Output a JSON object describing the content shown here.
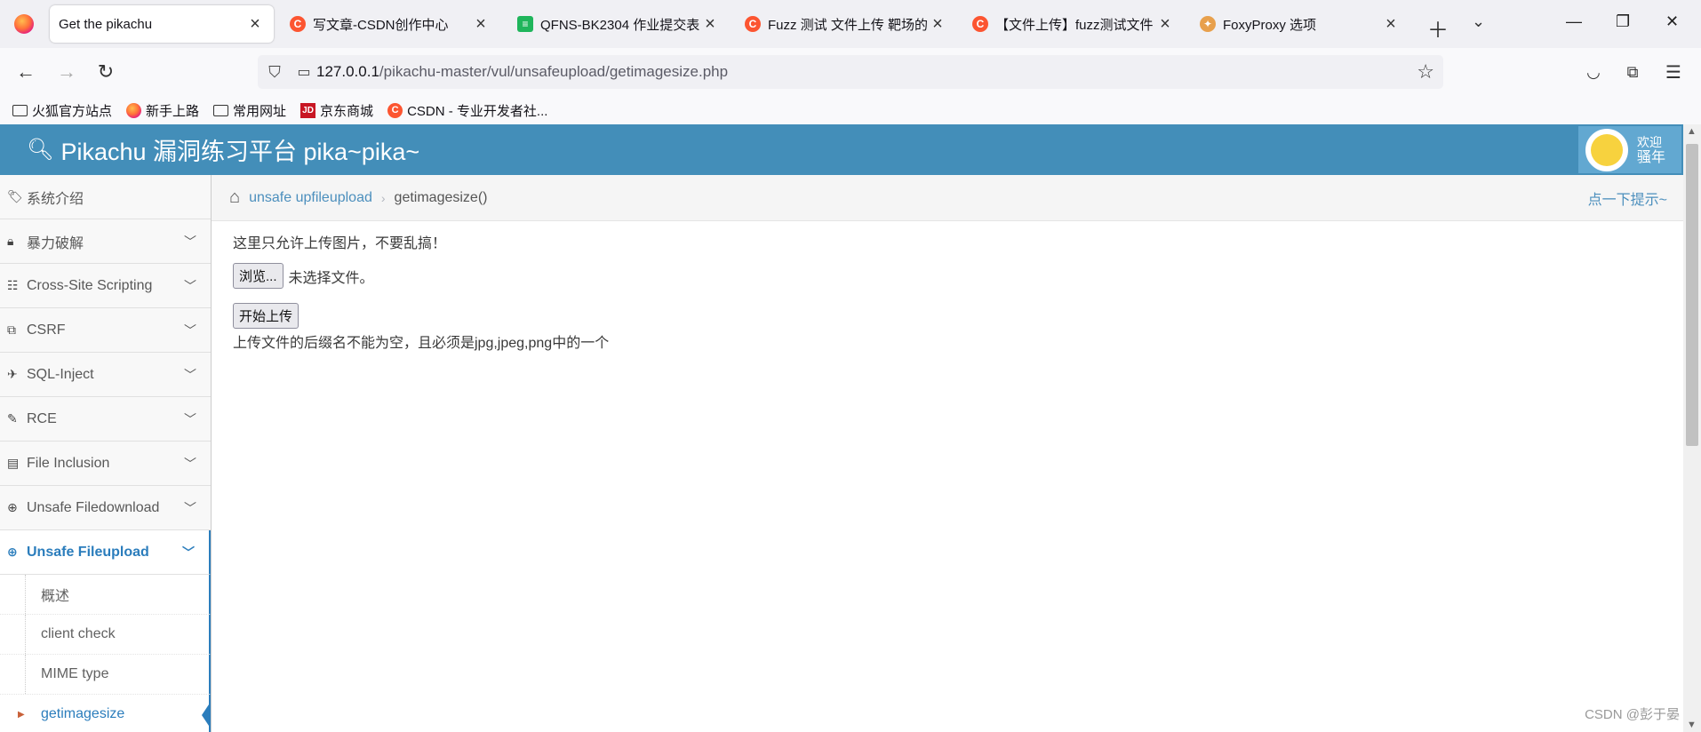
{
  "browser": {
    "tabs": [
      {
        "title": "Get the pikachu",
        "icon": "none",
        "active": true
      },
      {
        "title": "写文章-CSDN创作中心",
        "icon": "csdn-icon"
      },
      {
        "title": "QFNS-BK2304 作业提交表",
        "icon": "sheet-icon"
      },
      {
        "title": "Fuzz 测试 文件上传 靶场的",
        "icon": "csdn-icon"
      },
      {
        "title": "【文件上传】fuzz测试文件",
        "icon": "csdn-icon"
      },
      {
        "title": "FoxyProxy 选项",
        "icon": "foxyproxy-icon"
      }
    ],
    "url_host": "127.0.0.1",
    "url_path": "/pikachu-master/vul/unsafeupload/getimagesize.php",
    "bookmarks": [
      {
        "label": "火狐官方站点",
        "icon": "folder-icon"
      },
      {
        "label": "新手上路",
        "icon": "firefox-icon"
      },
      {
        "label": "常用网址",
        "icon": "folder-icon"
      },
      {
        "label": "京东商城",
        "icon": "jd-icon"
      },
      {
        "label": "CSDN - 专业开发者社...",
        "icon": "csdn-icon"
      }
    ]
  },
  "app": {
    "title": "Pikachu 漏洞练习平台 pika~pika~",
    "welcome": "欢迎",
    "username": "骚年"
  },
  "sidebar": {
    "items": [
      {
        "label": "系统介绍",
        "icon": "tags-icon"
      },
      {
        "label": "暴力破解",
        "icon": "lock-icon"
      },
      {
        "label": "Cross-Site Scripting",
        "icon": "list-icon"
      },
      {
        "label": "CSRF",
        "icon": "share-icon"
      },
      {
        "label": "SQL-Inject",
        "icon": "fighter-jet-icon"
      },
      {
        "label": "RCE",
        "icon": "pencil-icon"
      },
      {
        "label": "File Inclusion",
        "icon": "file-icon"
      },
      {
        "label": "Unsafe Filedownload",
        "icon": "download-icon"
      },
      {
        "label": "Unsafe Fileupload",
        "icon": "upload-icon"
      }
    ],
    "subitems": [
      {
        "label": "概述"
      },
      {
        "label": "client check"
      },
      {
        "label": "MIME type"
      },
      {
        "label": "getimagesize"
      }
    ]
  },
  "breadcrumb": {
    "parent": "unsafe upfileupload",
    "current": "getimagesize()",
    "hint": "点一下提示~"
  },
  "main": {
    "notice": "这里只允许上传图片，不要乱搞！",
    "browse_label": "浏览...",
    "no_file": "未选择文件。",
    "upload_label": "开始上传",
    "message": "上传文件的后缀名不能为空，且必须是jpg,jpeg,png中的一个"
  },
  "watermark": "CSDN @彭于晏",
  "colors": {
    "header": "#438eb9",
    "accent": "#2b7dbc",
    "link": "#4c8fbd"
  }
}
